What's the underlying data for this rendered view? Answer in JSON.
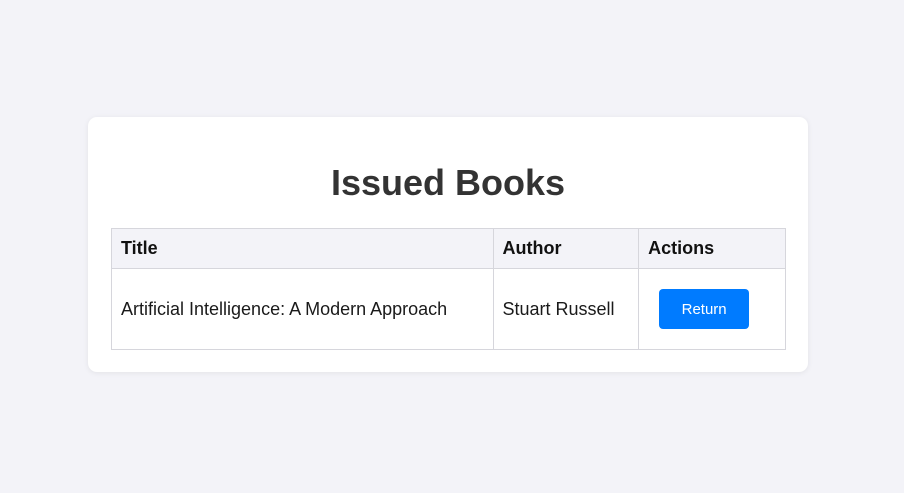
{
  "page": {
    "title": "Issued Books"
  },
  "table": {
    "headers": {
      "title": "Title",
      "author": "Author",
      "actions": "Actions"
    },
    "rows": [
      {
        "title": "Artificial Intelligence: A Modern Approach",
        "author": "Stuart Russell",
        "action_label": "Return"
      }
    ]
  },
  "colors": {
    "background": "#f3f3f8",
    "card": "#ffffff",
    "accent": "#007bff",
    "title_text": "#333333"
  }
}
